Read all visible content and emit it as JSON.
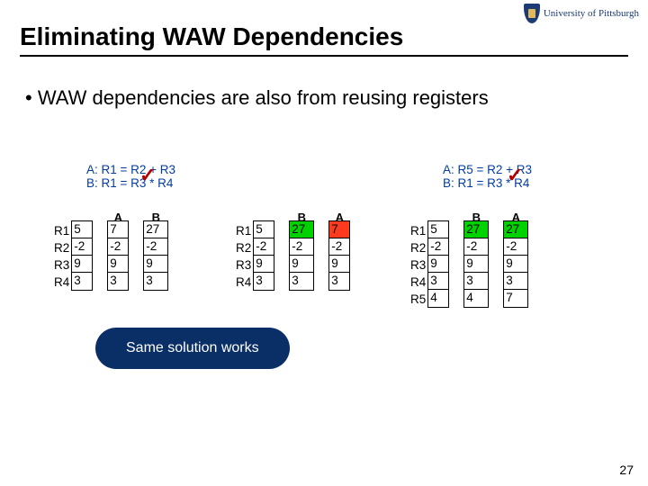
{
  "logo": {
    "text": "University of Pittsburgh"
  },
  "title": "Eliminating WAW Dependencies",
  "bullet": "• WAW dependencies are also from reusing registers",
  "code_left": {
    "l1": "A: R1 = R2 + R3",
    "l2": "B: R1 = R3 * R4"
  },
  "code_right": {
    "l1": "A: R5 = R2 + R3",
    "l2": "B: R1 = R3 * R4"
  },
  "tables": {
    "t1": {
      "rows": [
        "R1",
        "R2",
        "R3",
        "R4"
      ],
      "col_labels": [
        "",
        "A",
        "B"
      ],
      "cols": [
        [
          "5",
          "-2",
          "9",
          "3"
        ],
        [
          "7",
          "-2",
          "9",
          "3"
        ],
        [
          "27",
          "-2",
          "9",
          "3"
        ]
      ]
    },
    "t2": {
      "rows": [
        "R1",
        "R2",
        "R3",
        "R4"
      ],
      "col_labels": [
        "",
        "B",
        "A"
      ],
      "cols": [
        [
          "5",
          "-2",
          "9",
          "3"
        ],
        [
          "27",
          "-2",
          "9",
          "3"
        ],
        [
          "7",
          "-2",
          "9",
          "3"
        ]
      ],
      "hl_green": [
        1,
        0
      ],
      "hl_red": [
        2,
        0
      ]
    },
    "t3": {
      "rows": [
        "R1",
        "R2",
        "R3",
        "R4",
        "R5"
      ],
      "col_labels": [
        "",
        "B",
        "A"
      ],
      "cols": [
        [
          "5",
          "-2",
          "9",
          "3",
          "4"
        ],
        [
          "27",
          "-2",
          "9",
          "3",
          "4"
        ],
        [
          "27",
          "-2",
          "9",
          "3",
          "7"
        ]
      ],
      "hl_green_a": [
        1,
        0
      ],
      "hl_green_b": [
        2,
        0
      ]
    }
  },
  "callout": "Same solution works",
  "page_num": "27"
}
